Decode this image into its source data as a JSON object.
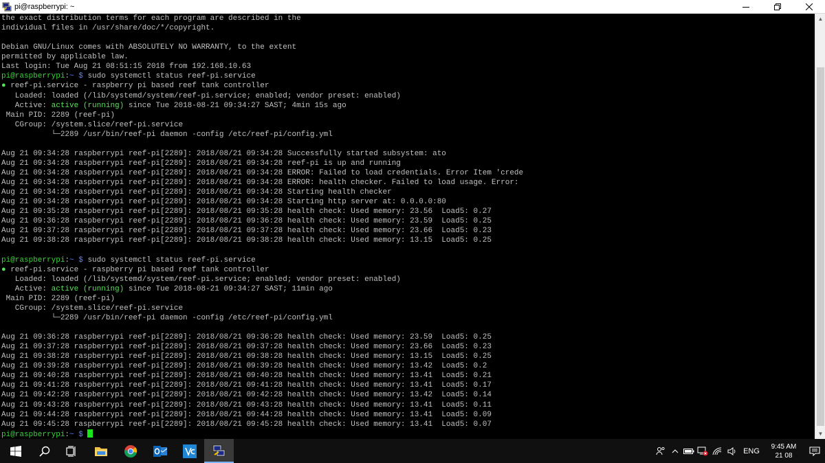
{
  "window": {
    "title": "pi@raspberrypi: ~",
    "controls": {
      "minimize": "—",
      "maximize": "❐",
      "close": "✕"
    }
  },
  "terminal": {
    "prompt": "pi@raspberrypi",
    "prompt_path": "~",
    "lines": [
      [
        {
          "t": "the exact distribution terms for each program are described in the",
          "c": "gray"
        }
      ],
      [
        {
          "t": "individual files in /usr/share/doc/*/copyright.",
          "c": "gray"
        }
      ],
      [
        {
          "t": "",
          "c": "gray"
        }
      ],
      [
        {
          "t": "Debian GNU/Linux comes with ABSOLUTELY NO WARRANTY, to the extent",
          "c": "gray"
        }
      ],
      [
        {
          "t": "permitted by applicable law.",
          "c": "gray"
        }
      ],
      [
        {
          "t": "Last login: Tue Aug 21 08:51:15 2018 from 192.168.10.63",
          "c": "gray"
        }
      ],
      [
        {
          "t": "pi@raspberrypi",
          "c": "green"
        },
        {
          "t": ":",
          "c": "gray"
        },
        {
          "t": "~ $",
          "c": "blue"
        },
        {
          "t": " sudo systemctl status reef-pi.service",
          "c": "gray"
        }
      ],
      [
        {
          "t": "●",
          "c": "bright"
        },
        {
          "t": " reef-pi.service - raspberry pi based reef tank controller",
          "c": "gray"
        }
      ],
      [
        {
          "t": "   Loaded: loaded (/lib/systemd/system/reef-pi.service; enabled; vendor preset: enabled)",
          "c": "gray"
        }
      ],
      [
        {
          "t": "   Active: ",
          "c": "gray"
        },
        {
          "t": "active (running)",
          "c": "bright"
        },
        {
          "t": " since Tue 2018-08-21 09:34:27 SAST; 4min 15s ago",
          "c": "gray"
        }
      ],
      [
        {
          "t": " Main PID: 2289 (reef-pi)",
          "c": "gray"
        }
      ],
      [
        {
          "t": "   CGroup: /system.slice/reef-pi.service",
          "c": "gray"
        }
      ],
      [
        {
          "t": "           └─2289 /usr/bin/reef-pi daemon -config /etc/reef-pi/config.yml",
          "c": "gray"
        }
      ],
      [
        {
          "t": "",
          "c": "gray"
        }
      ],
      [
        {
          "t": "Aug 21 09:34:28 raspberrypi reef-pi[2289]: 2018/08/21 09:34:28 Successfully started subsystem: ato",
          "c": "gray"
        }
      ],
      [
        {
          "t": "Aug 21 09:34:28 raspberrypi reef-pi[2289]: 2018/08/21 09:34:28 reef-pi is up and running",
          "c": "gray"
        }
      ],
      [
        {
          "t": "Aug 21 09:34:28 raspberrypi reef-pi[2289]: 2018/08/21 09:34:28 ERROR: Failed to load credentials. Error Item 'crede",
          "c": "gray"
        }
      ],
      [
        {
          "t": "Aug 21 09:34:28 raspberrypi reef-pi[2289]: 2018/08/21 09:34:28 ERROR: health checker. Failed to load usage. Error:",
          "c": "gray"
        }
      ],
      [
        {
          "t": "Aug 21 09:34:28 raspberrypi reef-pi[2289]: 2018/08/21 09:34:28 Starting health checker",
          "c": "gray"
        }
      ],
      [
        {
          "t": "Aug 21 09:34:28 raspberrypi reef-pi[2289]: 2018/08/21 09:34:28 Starting http server at: 0.0.0.0:80",
          "c": "gray"
        }
      ],
      [
        {
          "t": "Aug 21 09:35:28 raspberrypi reef-pi[2289]: 2018/08/21 09:35:28 health check: Used memory: 23.56  Load5: 0.27",
          "c": "gray"
        }
      ],
      [
        {
          "t": "Aug 21 09:36:28 raspberrypi reef-pi[2289]: 2018/08/21 09:36:28 health check: Used memory: 23.59  Load5: 0.25",
          "c": "gray"
        }
      ],
      [
        {
          "t": "Aug 21 09:37:28 raspberrypi reef-pi[2289]: 2018/08/21 09:37:28 health check: Used memory: 23.66  Load5: 0.23",
          "c": "gray"
        }
      ],
      [
        {
          "t": "Aug 21 09:38:28 raspberrypi reef-pi[2289]: 2018/08/21 09:38:28 health check: Used memory: 13.15  Load5: 0.25",
          "c": "gray"
        }
      ],
      [
        {
          "t": "",
          "c": "gray"
        }
      ],
      [
        {
          "t": "pi@raspberrypi",
          "c": "green"
        },
        {
          "t": ":",
          "c": "gray"
        },
        {
          "t": "~ $",
          "c": "blue"
        },
        {
          "t": " sudo systemctl status reef-pi.service",
          "c": "gray"
        }
      ],
      [
        {
          "t": "●",
          "c": "bright"
        },
        {
          "t": " reef-pi.service - raspberry pi based reef tank controller",
          "c": "gray"
        }
      ],
      [
        {
          "t": "   Loaded: loaded (/lib/systemd/system/reef-pi.service; enabled; vendor preset: enabled)",
          "c": "gray"
        }
      ],
      [
        {
          "t": "   Active: ",
          "c": "gray"
        },
        {
          "t": "active (running)",
          "c": "bright"
        },
        {
          "t": " since Tue 2018-08-21 09:34:27 SAST; 11min ago",
          "c": "gray"
        }
      ],
      [
        {
          "t": " Main PID: 2289 (reef-pi)",
          "c": "gray"
        }
      ],
      [
        {
          "t": "   CGroup: /system.slice/reef-pi.service",
          "c": "gray"
        }
      ],
      [
        {
          "t": "           └─2289 /usr/bin/reef-pi daemon -config /etc/reef-pi/config.yml",
          "c": "gray"
        }
      ],
      [
        {
          "t": "",
          "c": "gray"
        }
      ],
      [
        {
          "t": "Aug 21 09:36:28 raspberrypi reef-pi[2289]: 2018/08/21 09:36:28 health check: Used memory: 23.59  Load5: 0.25",
          "c": "gray"
        }
      ],
      [
        {
          "t": "Aug 21 09:37:28 raspberrypi reef-pi[2289]: 2018/08/21 09:37:28 health check: Used memory: 23.66  Load5: 0.23",
          "c": "gray"
        }
      ],
      [
        {
          "t": "Aug 21 09:38:28 raspberrypi reef-pi[2289]: 2018/08/21 09:38:28 health check: Used memory: 13.15  Load5: 0.25",
          "c": "gray"
        }
      ],
      [
        {
          "t": "Aug 21 09:39:28 raspberrypi reef-pi[2289]: 2018/08/21 09:39:28 health check: Used memory: 13.42  Load5: 0.2",
          "c": "gray"
        }
      ],
      [
        {
          "t": "Aug 21 09:40:28 raspberrypi reef-pi[2289]: 2018/08/21 09:40:28 health check: Used memory: 13.41  Load5: 0.21",
          "c": "gray"
        }
      ],
      [
        {
          "t": "Aug 21 09:41:28 raspberrypi reef-pi[2289]: 2018/08/21 09:41:28 health check: Used memory: 13.41  Load5: 0.17",
          "c": "gray"
        }
      ],
      [
        {
          "t": "Aug 21 09:42:28 raspberrypi reef-pi[2289]: 2018/08/21 09:42:28 health check: Used memory: 13.42  Load5: 0.14",
          "c": "gray"
        }
      ],
      [
        {
          "t": "Aug 21 09:43:28 raspberrypi reef-pi[2289]: 2018/08/21 09:43:28 health check: Used memory: 13.41  Load5: 0.11",
          "c": "gray"
        }
      ],
      [
        {
          "t": "Aug 21 09:44:28 raspberrypi reef-pi[2289]: 2018/08/21 09:44:28 health check: Used memory: 13.41  Load5: 0.09",
          "c": "gray"
        }
      ],
      [
        {
          "t": "Aug 21 09:45:28 raspberrypi reef-pi[2289]: 2018/08/21 09:45:28 health check: Used memory: 13.41  Load5: 0.07",
          "c": "gray"
        }
      ],
      [
        {
          "t": "pi@raspberrypi",
          "c": "green"
        },
        {
          "t": ":",
          "c": "gray"
        },
        {
          "t": "~ $",
          "c": "blue"
        },
        {
          "t": " ",
          "c": "gray"
        }
      ]
    ]
  },
  "taskbar": {
    "apps": [
      {
        "name": "start-button",
        "icon": "windows-logo-icon"
      },
      {
        "name": "search-button",
        "icon": "search-icon"
      },
      {
        "name": "task-view-button",
        "icon": "task-view-icon"
      },
      {
        "name": "file-explorer-button",
        "icon": "folder-icon"
      },
      {
        "name": "chrome-button",
        "icon": "chrome-icon"
      },
      {
        "name": "outlook-button",
        "icon": "outlook-icon"
      },
      {
        "name": "vscode-button",
        "icon": "vscode-icon"
      },
      {
        "name": "putty-button",
        "icon": "putty-icon"
      }
    ],
    "tray": {
      "language": "ENG",
      "time": "9:45 AM",
      "date": "21 08"
    }
  },
  "colors": {
    "terminal_bg": "#000000",
    "prompt_green": "#33d633",
    "prompt_blue": "#5a7bff",
    "text_gray": "#c0c0c0",
    "taskbar_bg": "#101010"
  }
}
